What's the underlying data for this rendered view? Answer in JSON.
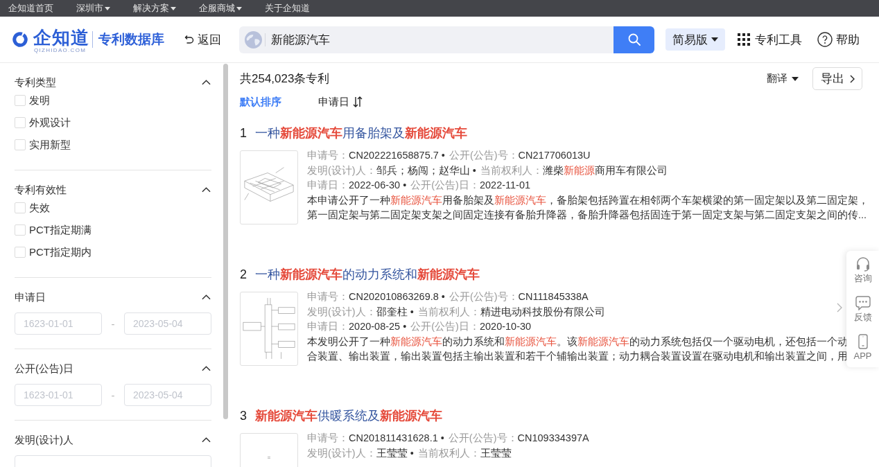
{
  "top_nav": [
    {
      "label": "企知道首页",
      "has_menu": false
    },
    {
      "label": "深圳市",
      "has_menu": true
    },
    {
      "label": "解决方案",
      "has_menu": true
    },
    {
      "label": "企服商城",
      "has_menu": true
    },
    {
      "label": "关于企知道",
      "has_menu": false
    }
  ],
  "header": {
    "logo": {
      "name": "企知道",
      "domain": "QIZHIDAO.COM"
    },
    "product": "专利数据库",
    "back": "返回",
    "search": {
      "value": "新能源汽车"
    },
    "mode": "简易版",
    "tools": "专利工具",
    "help": "帮助"
  },
  "filters": [
    {
      "kind": "checkboxes",
      "title": "专利类型",
      "expanded": true,
      "options": [
        {
          "label": "发明",
          "checked": false
        },
        {
          "label": "外观设计",
          "checked": false
        },
        {
          "label": "实用新型",
          "checked": false
        }
      ]
    },
    {
      "kind": "checkboxes",
      "title": "专利有效性",
      "expanded": true,
      "options": [
        {
          "label": "失效",
          "checked": false
        },
        {
          "label": "PCT指定期满",
          "checked": false
        },
        {
          "label": "PCT指定期内",
          "checked": false
        }
      ]
    },
    {
      "kind": "date_range",
      "title": "申请日",
      "expanded": true,
      "from": {
        "placeholder": "1623-01-01"
      },
      "separator": "-",
      "to": {
        "placeholder": "2023-05-04"
      }
    },
    {
      "kind": "date_range",
      "title": "公开(公告)日",
      "expanded": true,
      "from": {
        "placeholder": "1623-01-01"
      },
      "separator": "-",
      "to": {
        "placeholder": "2023-05-04"
      }
    },
    {
      "kind": "search",
      "title": "发明(设计)人",
      "expanded": true
    }
  ],
  "results_header": {
    "count": "共254,023条专利",
    "translate": "翻译",
    "export": "导出"
  },
  "sort_options": [
    {
      "label": "默认排序",
      "selected": true,
      "sortable": false
    },
    {
      "label": "申请日",
      "selected": false,
      "sortable": true
    }
  ],
  "results": [
    {
      "number": "1",
      "title": "一种**新能源汽车**用备胎架及**新能源汽车**",
      "meta": [
        [
          {
            "label": "申请号：",
            "value": "CN202221658875.7 •"
          },
          {
            "label": "公开(公告)号：",
            "value": "CN217706013U"
          }
        ],
        [
          {
            "label": "发明(设计)人：",
            "value": "邹兵；杨闯；赵华山 •"
          },
          {
            "label": "当前权利人：",
            "value": "潍柴**新能源**商用车有限公司"
          }
        ],
        [
          {
            "label": "申请日：",
            "value": "2022-06-30 •"
          },
          {
            "label": "公开(公告)日：",
            "value": "2022-11-01"
          }
        ]
      ],
      "description": [
        "本申请公开了一种**新能源汽车**用备胎架及**新能源汽车**，备胎架包括跨置在相邻两个车架横梁的第一固定架以及第二固定架，",
        "第一固定架与第二固定架支架之间固定连接有备胎升降器，备胎升降器包括固连于第一固定支架与第二固定支架之间的传..."
      ]
    },
    {
      "number": "2",
      "title": "一种**新能源汽车**的动力系统和**新能源汽车**",
      "meta": [
        [
          {
            "label": "申请号：",
            "value": "CN202010863269.8 •"
          },
          {
            "label": "公开(公告)号：",
            "value": "CN111845338A"
          }
        ],
        [
          {
            "label": "发明(设计)人：",
            "value": "邵奎柱 •"
          },
          {
            "label": "当前权利人：",
            "value": "精进电动科技股份有限公司"
          }
        ],
        [
          {
            "label": "申请日：",
            "value": "2020-08-25 •"
          },
          {
            "label": "公开(公告)日：",
            "value": "2020-10-30"
          }
        ]
      ],
      "description": [
        "本发明公开了一种**新能源汽车**的动力系统和**新能源汽车**。该**新能源汽车**的动力系统包括仅一个驱动电机，还包括一个动",
        "合装置、输出装置，输出装置包括主输出装置和若干个辅输出装置；动力耦合装置设置在驱动电机和输出装置之间，用"
      ]
    },
    {
      "number": "3",
      "title": "**新能源汽车**供暖系统及**新能源汽车**",
      "meta": [
        [
          {
            "label": "申请号：",
            "value": "CN201811431628.1 •"
          },
          {
            "label": "公开(公告)号：",
            "value": "CN109334397A"
          }
        ],
        [
          {
            "label": "发明(设计)人：",
            "value": "王莹莹 •"
          },
          {
            "label": "当前权利人：",
            "value": "王莹莹"
          }
        ]
      ]
    }
  ],
  "side_tools": [
    {
      "label": "咨询"
    },
    {
      "label": "反馈"
    },
    {
      "label": "APP"
    }
  ]
}
